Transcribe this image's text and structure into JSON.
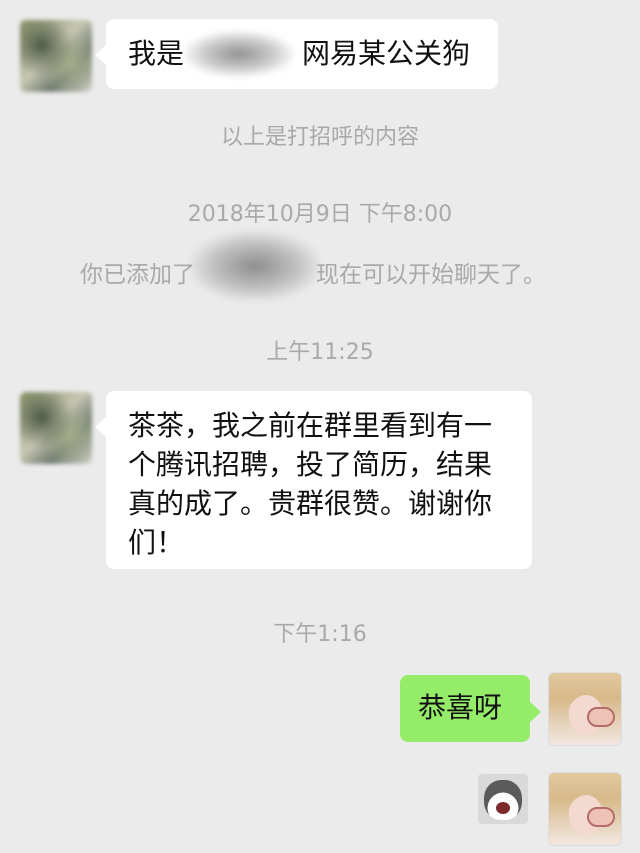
{
  "messages": {
    "first": {
      "prefix": "我是",
      "suffix": "网易某公关狗"
    },
    "greeting_note": "以上是打招呼的内容",
    "timestamp_1": "2018年10月9日 下午8:00",
    "added_note": {
      "prefix": "你已添加了",
      "suffix": "现在可以开始聊天了。"
    },
    "timestamp_2": "上午11:25",
    "long_message": "茶茶，我之前在群里看到有一个腾讯招聘，投了简历，结果真的成了。贵群很赞。谢谢你们！",
    "timestamp_3": "下午1:16",
    "reply": "恭喜呀"
  },
  "icons": {
    "left_avatar": "blurred-contact-avatar",
    "right_avatar": "user-avatar-girl",
    "sticker": "husky-dog-sticker"
  },
  "colors": {
    "background": "#ebebeb",
    "incoming_bubble": "#ffffff",
    "outgoing_bubble": "#95ec69",
    "system_text": "#a9a9a9"
  }
}
